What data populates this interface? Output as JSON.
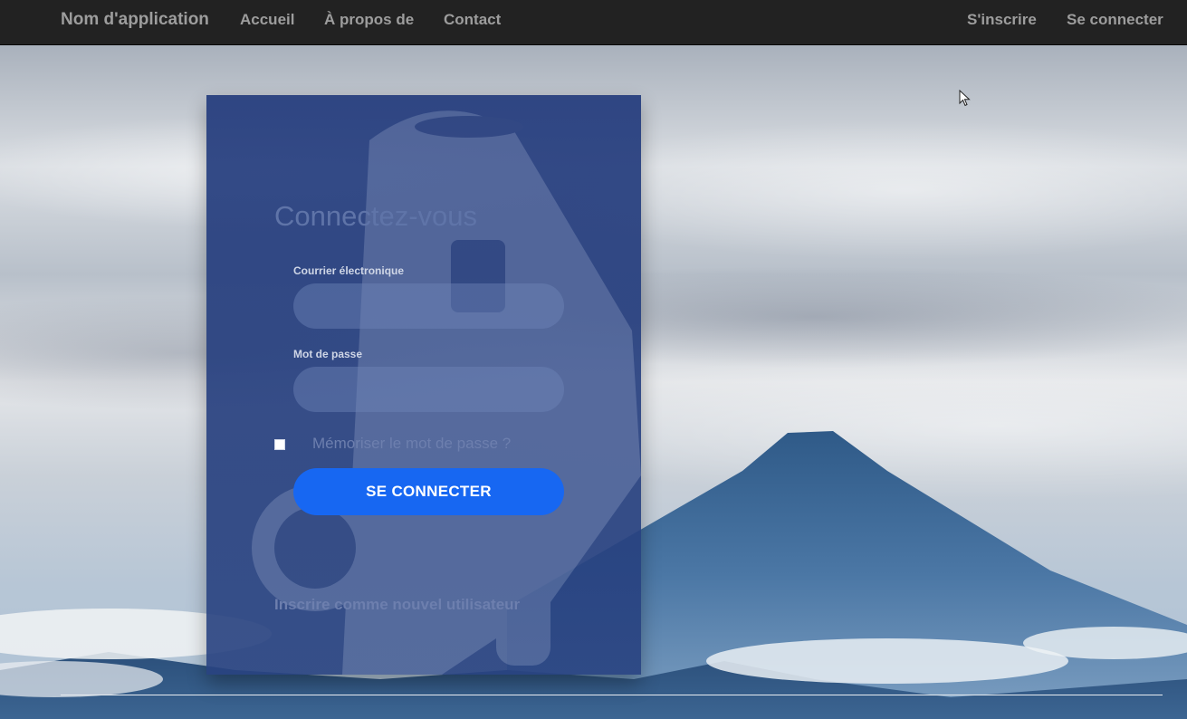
{
  "navbar": {
    "brand": "Nom d'application",
    "links": [
      "Accueil",
      "À propos de",
      "Contact"
    ],
    "right_links": [
      "S'inscrire",
      "Se connecter"
    ]
  },
  "login": {
    "title": "Connectez-vous",
    "email_label": "Courrier électronique",
    "email_value": "",
    "password_label": "Mot de passe",
    "password_value": "",
    "remember_label": "Mémoriser le mot de passe ?",
    "remember_checked": false,
    "submit_label": "SE CONNECTER",
    "register_link": "Inscrire comme nouvel utilisateur"
  },
  "colors": {
    "navbar_bg": "#222222",
    "navbar_text": "#9d9d9d",
    "card_bg": "#243c7d",
    "button_bg": "#1767f2"
  },
  "icons": [
    "mouse-cursor-icon"
  ]
}
